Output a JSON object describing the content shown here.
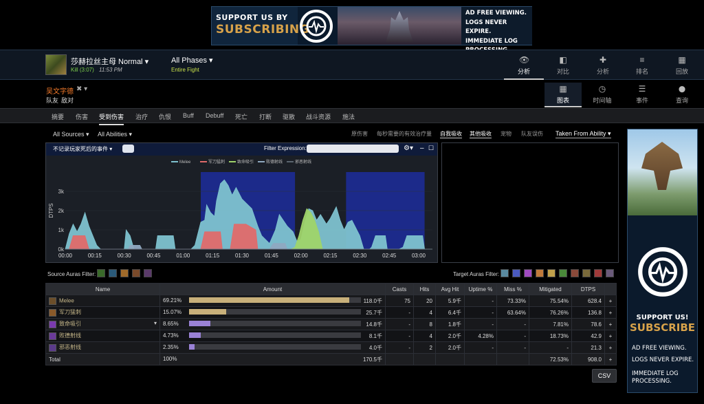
{
  "banner": {
    "line1": "SUPPORT US BY",
    "line2": "SUBSCRIBING",
    "perks": [
      "AD FREE VIEWING.",
      "LOGS NEVER EXPIRE.",
      "IMMEDIATE LOG",
      "PROCESSING."
    ]
  },
  "header": {
    "boss": "莎赫拉丝主母 Normal",
    "kill": "Kill (3:07)",
    "time": "11:53 PM",
    "phases": "All Phases",
    "phase_sub": "Entire Fight",
    "nav": [
      {
        "label": "分析",
        "icon": "eye-icon",
        "glyph": "👁",
        "active": true
      },
      {
        "label": "对比",
        "icon": "compare-icon",
        "glyph": "◧"
      },
      {
        "label": "分析",
        "icon": "puzzle-icon",
        "glyph": "✚"
      },
      {
        "label": "排名",
        "icon": "ranking-icon",
        "glyph": "≡"
      },
      {
        "label": "回放",
        "icon": "replay-icon",
        "glyph": "▦"
      }
    ]
  },
  "player": {
    "name": "吴文字德",
    "friend": "队友",
    "enemy": "敌对"
  },
  "views": [
    {
      "label": "图表",
      "icon": "table-icon",
      "glyph": "▦",
      "active": true
    },
    {
      "label": "时间轴",
      "icon": "clock-icon",
      "glyph": "◷"
    },
    {
      "label": "事件",
      "icon": "list-icon",
      "glyph": "☰"
    },
    {
      "label": "查询",
      "icon": "pin-icon",
      "glyph": "⬤"
    }
  ],
  "tabs": [
    "摘要",
    "伤害",
    "受到伤害",
    "治疗",
    "仇恨",
    "Buff",
    "Debuff",
    "死亡",
    "打断",
    "驱散",
    "战斗资源",
    "施法"
  ],
  "active_tab": "受到伤害",
  "filters": {
    "sources": "All Sources",
    "abilities": "All Abilities",
    "right": [
      "原伤害",
      "每秒需要的有效治疗量",
      "自我吸收",
      "其他吸收",
      "宠物",
      "队友误伤"
    ],
    "taken": "Taken From Ability"
  },
  "graph": {
    "death_label": "不记录玩家死后的事件",
    "filter_label": "Filter Expression:"
  },
  "chart_data": {
    "type": "area",
    "ylabel": "DTPS",
    "yticks": [
      "0k",
      "1k",
      "2k",
      "3k"
    ],
    "xticks": [
      "00:00",
      "00:15",
      "00:30",
      "00:45",
      "01:00",
      "01:15",
      "01:30",
      "01:45",
      "02:00",
      "02:15",
      "02:30",
      "02:45",
      "03:00"
    ],
    "ylim": [
      0,
      4000
    ],
    "xlim": [
      0,
      187
    ],
    "phase_bands": [
      [
        69,
        117
      ],
      [
        143,
        183
      ]
    ],
    "series": [
      {
        "name": "Melee",
        "color": "#7ec2cf",
        "points": [
          [
            0,
            0
          ],
          [
            2,
            800
          ],
          [
            4,
            1300
          ],
          [
            6,
            900
          ],
          [
            8,
            1300
          ],
          [
            10,
            1900
          ],
          [
            12,
            1200
          ],
          [
            14,
            700
          ],
          [
            16,
            200
          ],
          [
            18,
            0
          ],
          [
            30,
            0
          ],
          [
            31,
            1000
          ],
          [
            33,
            700
          ],
          [
            35,
            0
          ],
          [
            46,
            0
          ],
          [
            47,
            700
          ],
          [
            55,
            700
          ],
          [
            56,
            0
          ],
          [
            64,
            0
          ],
          [
            66,
            200
          ],
          [
            69,
            1400
          ],
          [
            71,
            1500
          ],
          [
            72,
            2300
          ],
          [
            74,
            1900
          ],
          [
            76,
            1700
          ],
          [
            77,
            2500
          ],
          [
            79,
            3400
          ],
          [
            81,
            3600
          ],
          [
            83,
            3300
          ],
          [
            85,
            2800
          ],
          [
            87,
            3200
          ],
          [
            88,
            3000
          ],
          [
            90,
            2600
          ],
          [
            92,
            2400
          ],
          [
            95,
            2100
          ],
          [
            98,
            1200
          ],
          [
            100,
            700
          ],
          [
            104,
            300
          ],
          [
            107,
            1000
          ],
          [
            109,
            1800
          ],
          [
            111,
            1500
          ],
          [
            113,
            1200
          ],
          [
            116,
            900
          ],
          [
            118,
            400
          ],
          [
            120,
            500
          ],
          [
            122,
            1400
          ],
          [
            124,
            2100
          ],
          [
            126,
            2000
          ],
          [
            128,
            1500
          ],
          [
            130,
            1800
          ],
          [
            133,
            1300
          ],
          [
            135,
            1600
          ],
          [
            138,
            2200
          ],
          [
            140,
            1500
          ],
          [
            142,
            1000
          ],
          [
            144,
            1400
          ],
          [
            146,
            1500
          ],
          [
            148,
            1100
          ],
          [
            150,
            700
          ],
          [
            152,
            0
          ],
          [
            155,
            0
          ],
          [
            156,
            100
          ],
          [
            158,
            700
          ],
          [
            163,
            700
          ],
          [
            164,
            0
          ],
          [
            170,
            0
          ],
          [
            172,
            100
          ],
          [
            174,
            700
          ],
          [
            182,
            700
          ],
          [
            183,
            0
          ],
          [
            187,
            0
          ]
        ]
      },
      {
        "name": "军刀猛刺",
        "color": "#e06a6a",
        "points": [
          [
            0,
            0
          ],
          [
            2,
            0
          ],
          [
            4,
            700
          ],
          [
            10,
            700
          ],
          [
            12,
            0
          ],
          [
            69,
            0
          ],
          [
            71,
            900
          ],
          [
            79,
            900
          ],
          [
            80,
            0
          ],
          [
            84,
            0
          ],
          [
            86,
            1300
          ],
          [
            92,
            1300
          ],
          [
            97,
            1000
          ],
          [
            98,
            0
          ],
          [
            187,
            0
          ]
        ]
      },
      {
        "name": "致命吸引",
        "color": "#9fd46a",
        "points": [
          [
            115,
            0
          ],
          [
            117,
            100
          ],
          [
            119,
            700
          ],
          [
            121,
            1500
          ],
          [
            123,
            2100
          ],
          [
            125,
            1900
          ],
          [
            127,
            1500
          ],
          [
            129,
            900
          ],
          [
            131,
            0
          ],
          [
            187,
            0
          ]
        ]
      },
      {
        "name": "败德射线",
        "color": "#8fa8c0",
        "points": [
          [
            0,
            0
          ],
          [
            32,
            0
          ],
          [
            33,
            200
          ],
          [
            38,
            200
          ],
          [
            39,
            0
          ],
          [
            104,
            0
          ],
          [
            106,
            300
          ],
          [
            112,
            300
          ],
          [
            113,
            0
          ],
          [
            187,
            0
          ]
        ]
      },
      {
        "name": "邪恶射线",
        "color": "#5c6670",
        "points": [
          [
            0,
            0
          ],
          [
            187,
            0
          ]
        ]
      }
    ]
  },
  "auras": {
    "source_label": "Source Auras Filter:",
    "target_label": "Target Auras Filter:"
  },
  "table": {
    "headers": [
      "Name",
      "Amount",
      "Casts",
      "Hits",
      "Avg Hit",
      "Uptime %",
      "Miss %",
      "Mitigated",
      "DTPS",
      ""
    ],
    "rows": [
      {
        "name": "Melee",
        "pct": "69.21%",
        "frac": 0.9321,
        "amount": "118.0千",
        "casts": "75",
        "hits": "20",
        "avg": "5.9千",
        "uptime": "-",
        "miss": "73.33%",
        "mit": "75.54%",
        "dtps": "628.4",
        "color": "#c8b07a",
        "icon": "melee-icon"
      },
      {
        "name": "军刀猛刺",
        "pct": "15.07%",
        "frac": 0.2178,
        "amount": "25.7千",
        "casts": "-",
        "hits": "4",
        "avg": "6.4千",
        "uptime": "-",
        "miss": "63.64%",
        "mit": "76.26%",
        "dtps": "136.8",
        "color": "#c8b07a",
        "icon": "saber-icon"
      },
      {
        "name": "致命吸引",
        "pct": "8.65%",
        "frac": 0.1254,
        "amount": "14.8千",
        "casts": "-",
        "hits": "8",
        "avg": "1.8千",
        "uptime": "-",
        "miss": "-",
        "mit": "7.81%",
        "dtps": "78.6",
        "color": "#9a82d6",
        "icon": "attraction-icon"
      },
      {
        "name": "败德射线",
        "pct": "4.73%",
        "frac": 0.0686,
        "amount": "8.1千",
        "casts": "-",
        "hits": "4",
        "avg": "2.0千",
        "uptime": "4.28%",
        "miss": "-",
        "mit": "18.73%",
        "dtps": "42.9",
        "color": "#9a82d6",
        "icon": "ray-icon"
      },
      {
        "name": "邪恶射线",
        "pct": "2.35%",
        "frac": 0.0339,
        "amount": "4.0千",
        "casts": "-",
        "hits": "2",
        "avg": "2.0千",
        "uptime": "-",
        "miss": "-",
        "mit": "-",
        "dtps": "21.3",
        "color": "#9a82d6",
        "icon": "evil-ray-icon"
      }
    ],
    "total": {
      "name": "Total",
      "pct": "100%",
      "amount": "170.5千",
      "mit": "72.53%",
      "dtps": "908.0"
    },
    "csv": "CSV"
  },
  "ad": {
    "t1": "SUPPORT US!",
    "t2": "SUBSCRIBE",
    "p1": [
      "AD FREE VIEWING."
    ],
    "p2": [
      "LOGS NEVER EXPIRE."
    ],
    "p3": [
      "IMMEDIATE LOG",
      "PROCESSING."
    ]
  }
}
